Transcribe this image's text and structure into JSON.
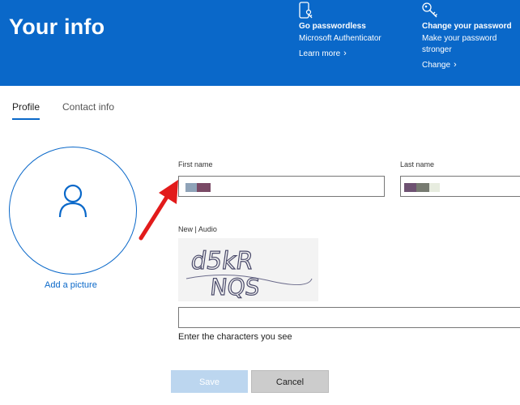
{
  "banner": {
    "title": "Your info",
    "promos": [
      {
        "icon": "phone-key-icon",
        "title": "Go passwordless",
        "desc1": "Microsoft Authenticator",
        "desc2": "",
        "link": "Learn more"
      },
      {
        "icon": "key-icon",
        "title": "Change your password",
        "desc1": "Make your password",
        "desc2": "stronger",
        "link": "Change"
      }
    ]
  },
  "tabs": [
    {
      "label": "Profile",
      "active": true
    },
    {
      "label": "Contact info",
      "active": false
    }
  ],
  "avatar": {
    "add_label": "Add a picture"
  },
  "form": {
    "first_name_label": "First name",
    "last_name_label": "Last name",
    "captcha_label": "New | Audio",
    "captcha_hint": "Enter the characters you see",
    "captcha_text": "d5kR NQS",
    "save_label": "Save",
    "cancel_label": "Cancel"
  },
  "colors": {
    "accent": "#0a68c9",
    "arrow": "#e21b1b"
  }
}
